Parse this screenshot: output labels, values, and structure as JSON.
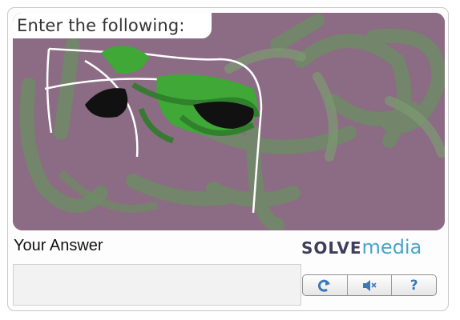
{
  "captcha": {
    "prompt": "Enter the following:",
    "image_desc_icon": "distorted-captcha-image-icon"
  },
  "answer": {
    "label": "Your Answer",
    "value": "",
    "placeholder": ""
  },
  "brand": {
    "part1": "SOLVE",
    "part2": "media"
  },
  "buttons": {
    "refresh_icon": "refresh-icon",
    "audio_icon": "audio-icon",
    "help_label": "?",
    "accent_color": "#3a78b8"
  },
  "colors": {
    "captcha_background": "#8c6b84",
    "brand_dark": "#3d3d5c",
    "brand_blue": "#4aa3c8"
  }
}
